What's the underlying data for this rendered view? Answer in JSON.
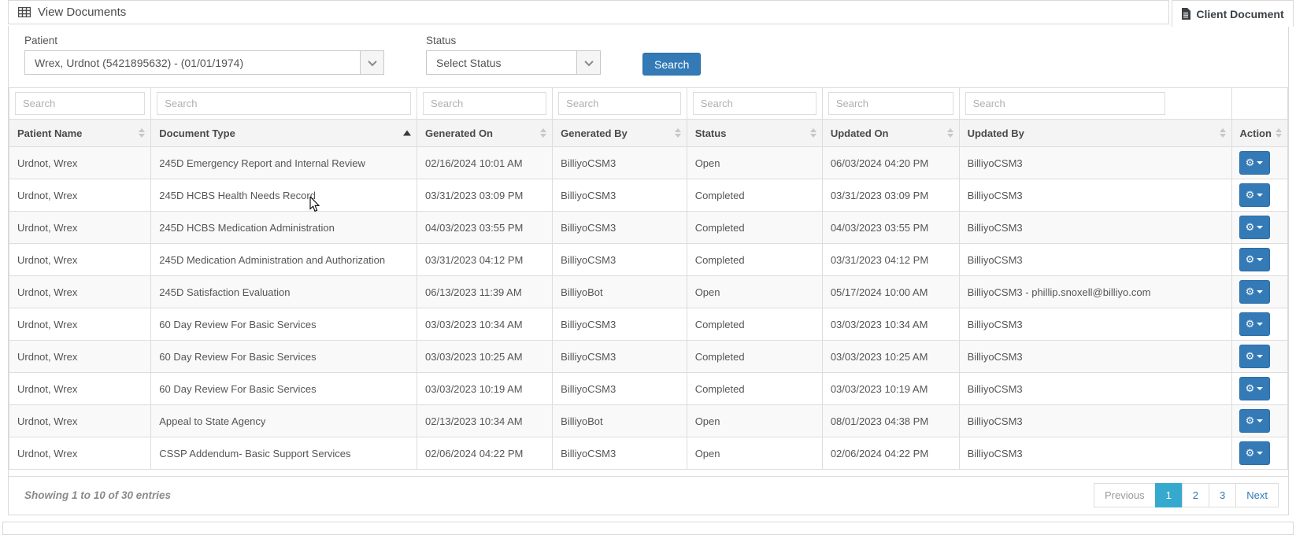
{
  "header": {
    "title": "View Documents",
    "client_document_tab": "Client Document"
  },
  "filters": {
    "patient_label": "Patient",
    "patient_value": "Wrex, Urdnot (5421895632) - (01/01/1974)",
    "status_label": "Status",
    "status_value": "Select Status",
    "search_button": "Search"
  },
  "table": {
    "search_placeholder": "Search",
    "columns": [
      {
        "label": "Patient Name",
        "sort": "none",
        "searchable": true
      },
      {
        "label": "Document Type",
        "sort": "asc",
        "searchable": true
      },
      {
        "label": "Generated On",
        "sort": "none",
        "searchable": true
      },
      {
        "label": "Generated By",
        "sort": "none",
        "searchable": true
      },
      {
        "label": "Status",
        "sort": "none",
        "searchable": true
      },
      {
        "label": "Updated On",
        "sort": "none",
        "searchable": true
      },
      {
        "label": "Updated By",
        "sort": "none",
        "searchable": true
      },
      {
        "label": "Action",
        "sort": "none",
        "searchable": false
      }
    ],
    "rows": [
      {
        "patient_name": "Urdnot, Wrex",
        "document_type": "245D Emergency Report and Internal Review",
        "generated_on": "02/16/2024 10:01 AM",
        "generated_by": "BilliyoCSM3",
        "status": "Open",
        "updated_on": "06/03/2024 04:20 PM",
        "updated_by": "BilliyoCSM3"
      },
      {
        "patient_name": "Urdnot, Wrex",
        "document_type": "245D HCBS Health Needs Record",
        "generated_on": "03/31/2023 03:09 PM",
        "generated_by": "BilliyoCSM3",
        "status": "Completed",
        "updated_on": "03/31/2023 03:09 PM",
        "updated_by": "BilliyoCSM3"
      },
      {
        "patient_name": "Urdnot, Wrex",
        "document_type": "245D HCBS Medication Administration",
        "generated_on": "04/03/2023 03:55 PM",
        "generated_by": "BilliyoCSM3",
        "status": "Completed",
        "updated_on": "04/03/2023 03:55 PM",
        "updated_by": "BilliyoCSM3"
      },
      {
        "patient_name": "Urdnot, Wrex",
        "document_type": "245D Medication Administration and Authorization",
        "generated_on": "03/31/2023 04:12 PM",
        "generated_by": "BilliyoCSM3",
        "status": "Completed",
        "updated_on": "03/31/2023 04:12 PM",
        "updated_by": "BilliyoCSM3"
      },
      {
        "patient_name": "Urdnot, Wrex",
        "document_type": "245D Satisfaction Evaluation",
        "generated_on": "06/13/2023 11:39 AM",
        "generated_by": "BilliyoBot",
        "status": "Open",
        "updated_on": "05/17/2024 10:00 AM",
        "updated_by": "BilliyoCSM3 - phillip.snoxell@billiyo.com"
      },
      {
        "patient_name": "Urdnot, Wrex",
        "document_type": "60 Day Review For Basic Services",
        "generated_on": "03/03/2023 10:34 AM",
        "generated_by": "BilliyoCSM3",
        "status": "Completed",
        "updated_on": "03/03/2023 10:34 AM",
        "updated_by": "BilliyoCSM3"
      },
      {
        "patient_name": "Urdnot, Wrex",
        "document_type": "60 Day Review For Basic Services",
        "generated_on": "03/03/2023 10:25 AM",
        "generated_by": "BilliyoCSM3",
        "status": "Completed",
        "updated_on": "03/03/2023 10:25 AM",
        "updated_by": "BilliyoCSM3"
      },
      {
        "patient_name": "Urdnot, Wrex",
        "document_type": "60 Day Review For Basic Services",
        "generated_on": "03/03/2023 10:19 AM",
        "generated_by": "BilliyoCSM3",
        "status": "Completed",
        "updated_on": "03/03/2023 10:19 AM",
        "updated_by": "BilliyoCSM3"
      },
      {
        "patient_name": "Urdnot, Wrex",
        "document_type": "Appeal to State Agency",
        "generated_on": "02/13/2023 10:34 AM",
        "generated_by": "BilliyoBot",
        "status": "Open",
        "updated_on": "08/01/2023 04:38 PM",
        "updated_by": "BilliyoCSM3"
      },
      {
        "patient_name": "Urdnot, Wrex",
        "document_type": "CSSP Addendum- Basic Support Services",
        "generated_on": "02/06/2024 04:22 PM",
        "generated_by": "BilliyoCSM3",
        "status": "Open",
        "updated_on": "02/06/2024 04:22 PM",
        "updated_by": "BilliyoCSM3"
      }
    ]
  },
  "footer": {
    "showing_text": "Showing 1 to 10 of 30 entries",
    "pagination": [
      "Previous",
      "1",
      "2",
      "3",
      "Next"
    ],
    "active_page": "1"
  },
  "icons": {
    "action_gear": "gear-icon",
    "action_caret": "caret-down-icon"
  },
  "colors": {
    "primary_button": "#337ab7",
    "primary_button_border": "#2e6da4",
    "active_page_bg": "#36a9ce",
    "panel_border": "#d9d9d9",
    "header_row_bg": "#f4f4f4",
    "stripe_row_bg": "#f9f9f9"
  }
}
